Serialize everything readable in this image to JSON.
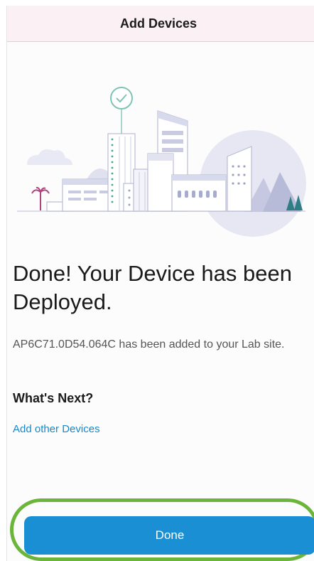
{
  "header": {
    "title": "Add Devices"
  },
  "illustration": {
    "icon": "city-buildings-illustration",
    "badge_icon": "checkmark-circle-icon"
  },
  "main": {
    "headline": "Done! Your Device has been Deployed.",
    "description": "AP6C71.0D54.064C has been added to your Lab site.",
    "next_heading": "What's Next?",
    "add_link": "Add other Devices"
  },
  "footer": {
    "done_label": "Done"
  },
  "colors": {
    "accent": "#1b8fd4",
    "link": "#1589c9",
    "highlight": "#6ab53a",
    "header_bg": "#fbf1f5"
  }
}
